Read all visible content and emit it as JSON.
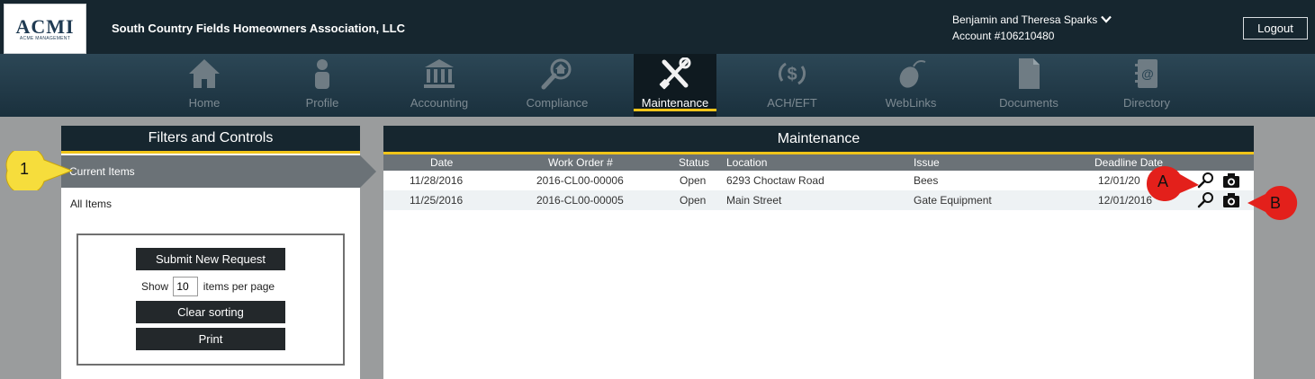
{
  "header": {
    "logo_text": "ACMI",
    "logo_subtext": "Acme Management",
    "association_name": "South Country Fields Homeowners Association, LLC",
    "user_name": "Benjamin and Theresa Sparks",
    "account_number": "Account #106210480",
    "logout_label": "Logout"
  },
  "nav": {
    "items": [
      {
        "label": "Home",
        "icon": "home-icon"
      },
      {
        "label": "Profile",
        "icon": "profile-icon"
      },
      {
        "label": "Accounting",
        "icon": "bank-icon"
      },
      {
        "label": "Compliance",
        "icon": "magnifier-house-icon"
      },
      {
        "label": "Maintenance",
        "icon": "tools-icon"
      },
      {
        "label": "ACH/EFT",
        "icon": "dollar-cycle-icon"
      },
      {
        "label": "WebLinks",
        "icon": "mouse-icon"
      },
      {
        "label": "Documents",
        "icon": "document-icon"
      },
      {
        "label": "Directory",
        "icon": "address-book-icon"
      }
    ],
    "active": "Maintenance"
  },
  "filters": {
    "title": "Filters and Controls",
    "current_items": "Current Items",
    "all_items": "All Items",
    "submit_label": "Submit New Request",
    "show_label": "Show",
    "per_page_value": "10",
    "per_page_suffix": "items per page",
    "clear_sorting_label": "Clear sorting",
    "print_label": "Print"
  },
  "maintenance": {
    "title": "Maintenance",
    "columns": [
      "Date",
      "Work Order #",
      "Status",
      "Location",
      "Issue",
      "Deadline Date"
    ],
    "rows": [
      {
        "date": "11/28/2016",
        "work_order": "2016-CL00-00006",
        "status": "Open",
        "location": "6293 Choctaw Road",
        "issue": "Bees",
        "deadline": "12/01/20"
      },
      {
        "date": "11/25/2016",
        "work_order": "2016-CL00-00005",
        "status": "Open",
        "location": "Main Street",
        "issue": "Gate Equipment",
        "deadline": "12/01/2016"
      }
    ]
  },
  "callouts": {
    "one": "1",
    "a": "A",
    "b": "B"
  },
  "colors": {
    "header_bg": "#16262f",
    "accent_yellow": "#f0c419",
    "gray_band": "#6b7277",
    "callout_red": "#e3201b",
    "callout_yellow": "#f6dd3c"
  }
}
